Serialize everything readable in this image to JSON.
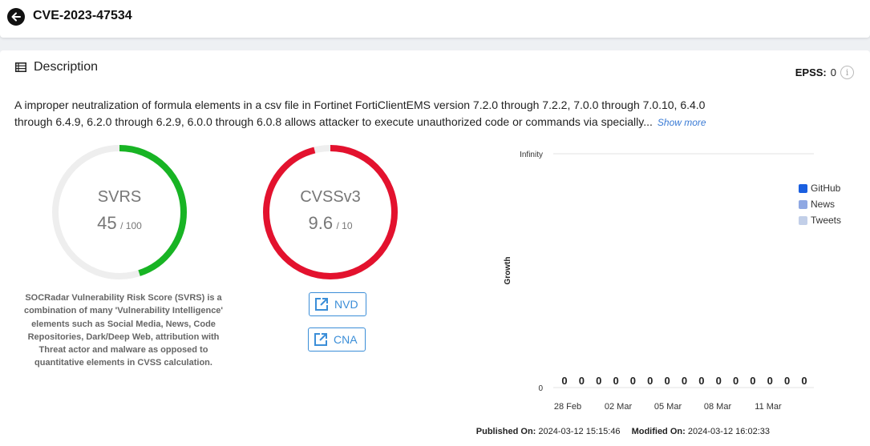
{
  "header": {
    "title": "CVE-2023-47534"
  },
  "description": {
    "heading": "Description",
    "text": "A improper neutralization of formula elements in a csv file in Fortinet FortiClientEMS version 7.2.0 through 7.2.2, 7.0.0 through 7.0.10, 6.4.0 through 6.4.9, 6.2.0 through 6.2.9, 6.0.0 through 6.0.8 allows attacker to execute unauthorized code or commands via specially...",
    "show_more": "Show more"
  },
  "epss": {
    "label": "EPSS:",
    "value": "0"
  },
  "svrs": {
    "label": "SVRS",
    "score": "45",
    "max": "/ 100",
    "fraction": 0.45,
    "color": "#18b424",
    "track_color": "#eeeeee",
    "note": "SOCRadar Vulnerability Risk Score (SVRS) is a combination of many 'Vulnerability Intelligence' elements such as Social Media, News, Code Repositories, Dark/Deep Web, attribution with Threat actor and malware as opposed to quantitative elements in CVSS calculation."
  },
  "cvss": {
    "label": "CVSSv3",
    "score": "9.6",
    "max": "/ 10",
    "fraction": 0.96,
    "color": "#e3122e",
    "track_color": "#eeeeee"
  },
  "links": {
    "nvd": "NVD",
    "cna": "CNA",
    "color": "#3b8ed8"
  },
  "chart_data": {
    "type": "bar",
    "ylabel": "Growth",
    "y_ticks": [
      "Infinity",
      "0"
    ],
    "x_ticks": [
      "28 Feb",
      "02 Mar",
      "05 Mar",
      "08 Mar",
      "11 Mar"
    ],
    "bar_labels": [
      "0",
      "0",
      "0",
      "0",
      "0",
      "0",
      "0",
      "0",
      "0",
      "0",
      "0",
      "0",
      "0",
      "0",
      "0"
    ],
    "series": [
      {
        "name": "GitHub",
        "color": "#1a5fe0",
        "values": [
          0,
          0,
          0,
          0,
          0,
          0,
          0,
          0,
          0,
          0,
          0,
          0,
          0,
          0,
          0
        ]
      },
      {
        "name": "News",
        "color": "#8fa8e3",
        "values": [
          0,
          0,
          0,
          0,
          0,
          0,
          0,
          0,
          0,
          0,
          0,
          0,
          0,
          0,
          0
        ]
      },
      {
        "name": "Tweets",
        "color": "#c2cfe8",
        "values": [
          0,
          0,
          0,
          0,
          0,
          0,
          0,
          0,
          0,
          0,
          0,
          0,
          0,
          0,
          0
        ]
      }
    ]
  },
  "footer": {
    "published_label": "Published On:",
    "published_value": "2024-03-12 15:15:46",
    "modified_label": "Modified On:",
    "modified_value": "2024-03-12 16:02:33"
  }
}
